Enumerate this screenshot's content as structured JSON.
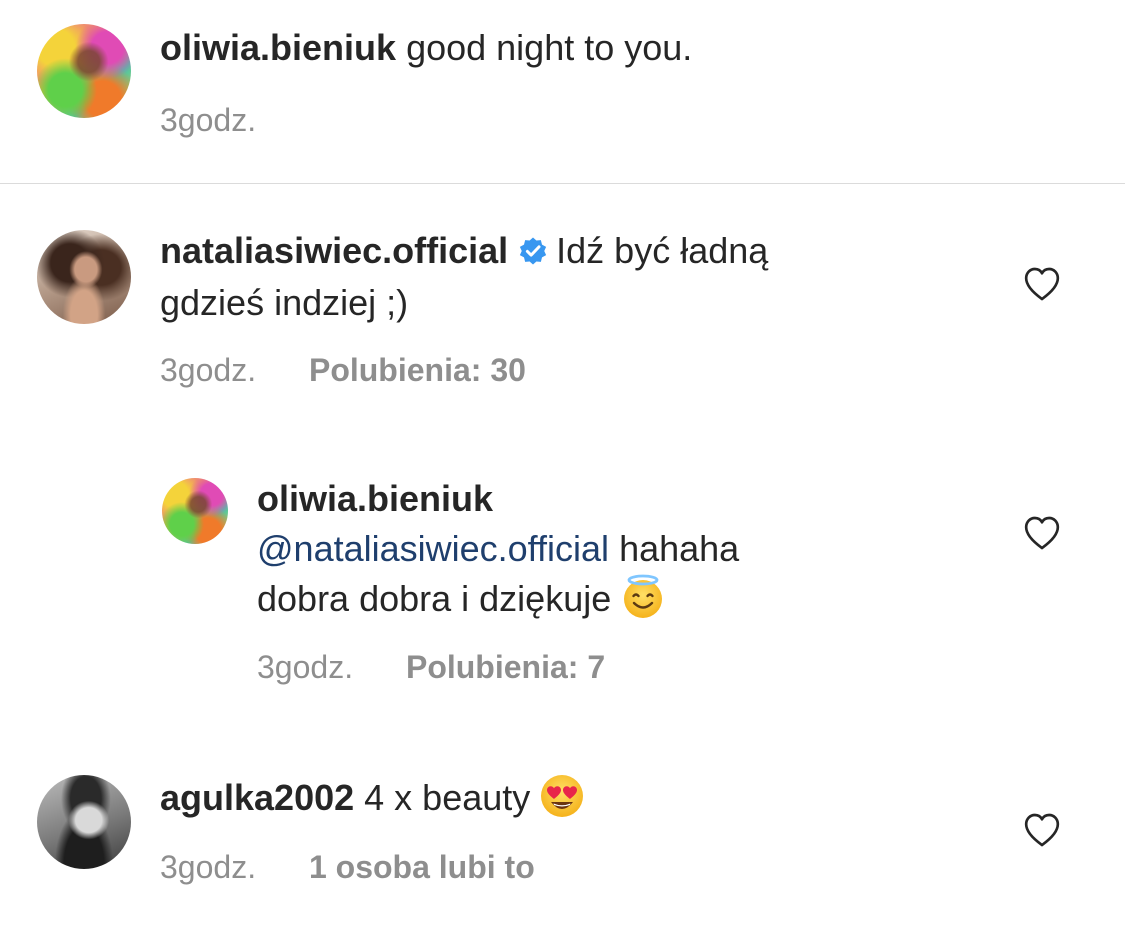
{
  "comments": [
    {
      "username": "oliwia.bieniuk",
      "text": "good night to you.",
      "time": "3godz."
    },
    {
      "username": "nataliasiwiec.official",
      "verified": true,
      "text_line1": "Idź być ładną",
      "text_line2": "gdzieś indziej ;)",
      "time": "3godz.",
      "likes": "Polubienia: 30",
      "reply": {
        "username": "oliwia.bieniuk",
        "mention": "@nataliasiwiec.official",
        "text_line1": "hahaha",
        "text_line2": "dobra dobra i dziękuje",
        "emoji": "smiling-face-with-halo-emoji",
        "time": "3godz.",
        "likes": "Polubienia: 7"
      }
    },
    {
      "username": "agulka2002",
      "text": "4 x beauty",
      "emoji": "heart-eyes-emoji",
      "time": "3godz.",
      "likes": "1 osoba lubi to"
    }
  ],
  "icons": {
    "like": "heart-outline-icon",
    "verified": "verified-badge-icon"
  },
  "colors": {
    "text": "#262626",
    "meta": "#8e8e8e",
    "mention": "#1f3f6d",
    "verified": "#3897f0",
    "divider": "#dbdbdb"
  }
}
